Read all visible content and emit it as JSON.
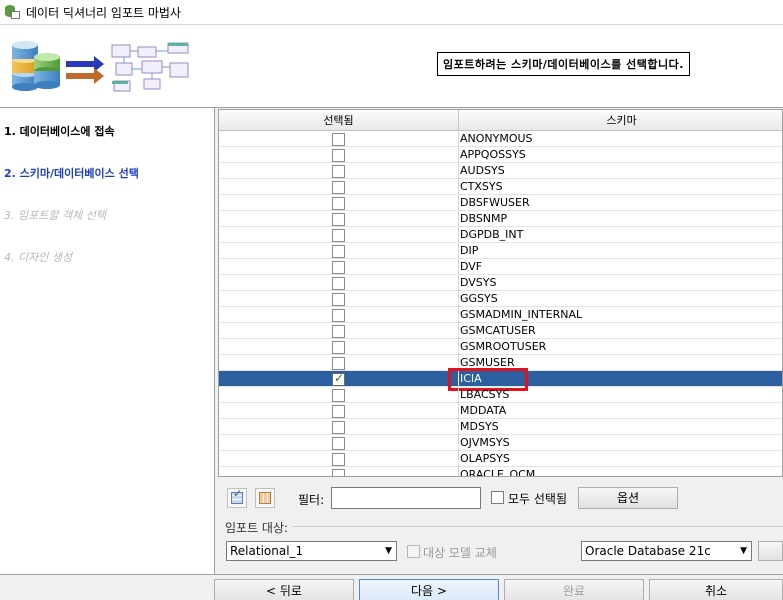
{
  "window": {
    "title": "데이터 딕셔너리 임포트 마법사"
  },
  "header": {
    "message": "임포트하려는 스키마/데이터베이스를 선택합니다."
  },
  "steps": [
    {
      "label": "1. 데이터베이스에 접속",
      "state": "done"
    },
    {
      "label": "2. 스키마/데이터베이스 선택",
      "state": "active"
    },
    {
      "label": "3. 임포트할 객체 선택",
      "state": "future"
    },
    {
      "label": "4. 디자인 생성",
      "state": "future"
    }
  ],
  "table": {
    "columns": [
      "선택됨",
      "스키마"
    ],
    "rows": [
      {
        "schema": "ANONYMOUS",
        "checked": false
      },
      {
        "schema": "APPQOSSYS",
        "checked": false
      },
      {
        "schema": "AUDSYS",
        "checked": false
      },
      {
        "schema": "CTXSYS",
        "checked": false
      },
      {
        "schema": "DBSFWUSER",
        "checked": false
      },
      {
        "schema": "DBSNMP",
        "checked": false
      },
      {
        "schema": "DGPDB_INT",
        "checked": false
      },
      {
        "schema": "DIP",
        "checked": false
      },
      {
        "schema": "DVF",
        "checked": false
      },
      {
        "schema": "DVSYS",
        "checked": false
      },
      {
        "schema": "GGSYS",
        "checked": false
      },
      {
        "schema": "GSMADMIN_INTERNAL",
        "checked": false
      },
      {
        "schema": "GSMCATUSER",
        "checked": false
      },
      {
        "schema": "GSMROOTUSER",
        "checked": false
      },
      {
        "schema": "GSMUSER",
        "checked": false
      },
      {
        "schema": "ICIA",
        "checked": true
      },
      {
        "schema": "LBACSYS",
        "checked": false
      },
      {
        "schema": "MDDATA",
        "checked": false
      },
      {
        "schema": "MDSYS",
        "checked": false
      },
      {
        "schema": "OJVMSYS",
        "checked": false
      },
      {
        "schema": "OLAPSYS",
        "checked": false
      },
      {
        "schema": "ORACLE_OCM",
        "checked": false
      }
    ]
  },
  "filter": {
    "label": "필터:",
    "value": "",
    "select_all_label": "모두 선택됨",
    "options_button": "옵션"
  },
  "import_target": {
    "group_label": "임포트 대상:",
    "model": "Relational_1",
    "replace_label": "대상 모델 교체",
    "database": "Oracle Database 21c"
  },
  "nav": {
    "back": "< 뒤로",
    "next": "다음 >",
    "finish": "완료",
    "cancel": "취소"
  },
  "colors": {
    "selection": "#2b5fa0",
    "active_step": "#1f3fbf",
    "highlight_box": "#e0121c"
  }
}
